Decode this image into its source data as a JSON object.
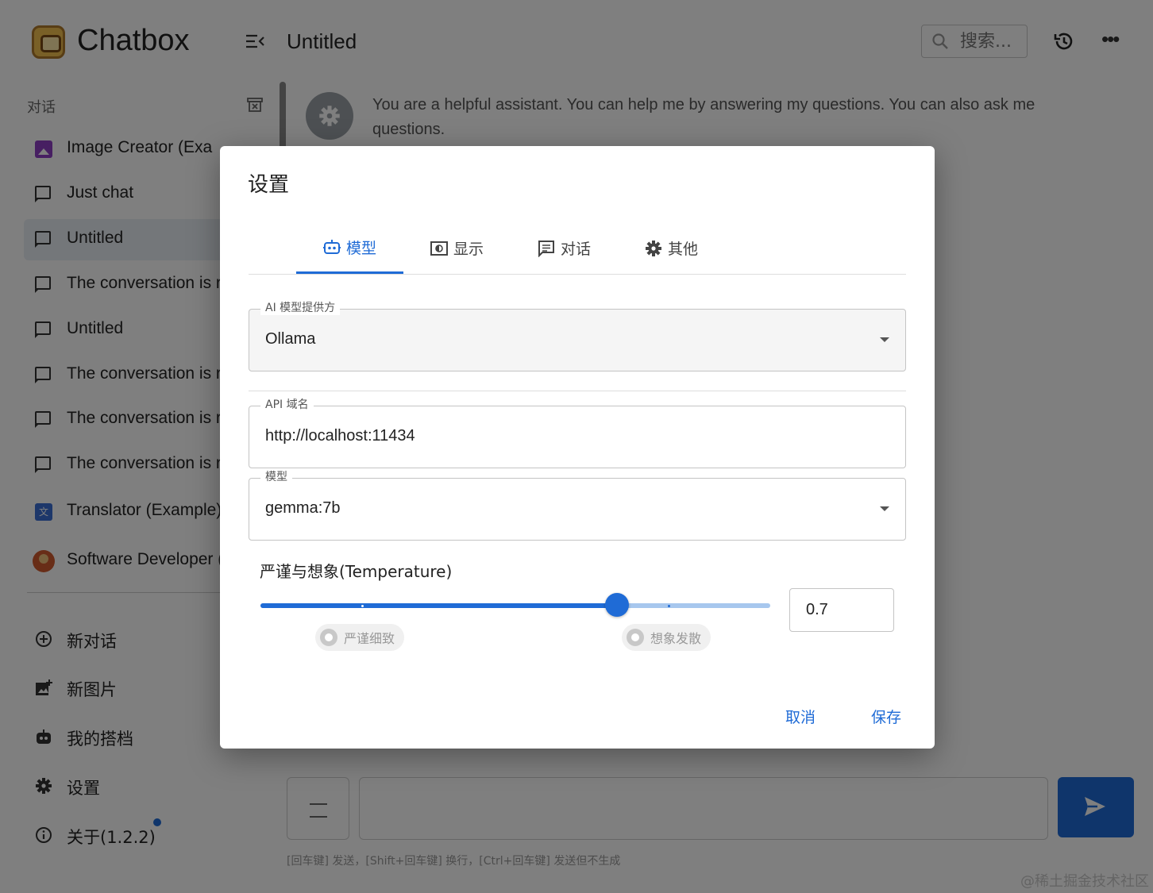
{
  "app": {
    "name": "Chatbox",
    "header_title": "Untitled",
    "search_placeholder": "搜索...",
    "sidebar_label": "对话",
    "sessions": [
      {
        "label": "Image Creator (Exa",
        "icon": "image-creator-avatar"
      },
      {
        "label": "Just chat",
        "icon": "chat-bubble-icon"
      },
      {
        "label": "Untitled",
        "icon": "chat-bubble-icon",
        "active": true
      },
      {
        "label": "The conversation is r",
        "icon": "chat-bubble-icon"
      },
      {
        "label": "Untitled",
        "icon": "chat-bubble-icon"
      },
      {
        "label": "The conversation is r",
        "icon": "chat-bubble-icon"
      },
      {
        "label": "The conversation is r",
        "icon": "chat-bubble-icon"
      },
      {
        "label": "The conversation is r",
        "icon": "chat-bubble-icon"
      },
      {
        "label": "Translator (Example)",
        "icon": "translator-avatar"
      },
      {
        "label": "Software Developer (",
        "icon": "software-developer-avatar"
      }
    ],
    "menu": {
      "new_chat": "新对话",
      "new_image": "新图片",
      "my_copilots": "我的搭档",
      "settings": "设置",
      "about": "关于(1.2.2)"
    },
    "system_message": "You are a helpful assistant. You can help me by answering my questions. You can also ask me questions.",
    "input_hint": "[回车键] 发送，[Shift+回车键] 换行，[Ctrl+回车键] 发送但不生成",
    "watermark": "@稀土掘金技术社区",
    "accent_color": "#1f6bd6"
  },
  "dialog": {
    "title": "设置",
    "tabs": [
      {
        "label": "模型",
        "icon": "robot-icon",
        "active": true
      },
      {
        "label": "显示",
        "icon": "display-icon"
      },
      {
        "label": "对话",
        "icon": "chat-icon"
      },
      {
        "label": "其他",
        "icon": "gear-icon"
      }
    ],
    "provider": {
      "label": "AI 模型提供方",
      "value": "Ollama"
    },
    "api_host": {
      "label": "API 域名",
      "value": "http://localhost:11434"
    },
    "model": {
      "label": "模型",
      "value": "gemma:7b"
    },
    "temperature": {
      "label": "严谨与想象(Temperature)",
      "value": "0.7",
      "level": 0.7,
      "chip_left": "严谨细致",
      "chip_right": "想象发散"
    },
    "cancel": "取消",
    "save": "保存"
  }
}
